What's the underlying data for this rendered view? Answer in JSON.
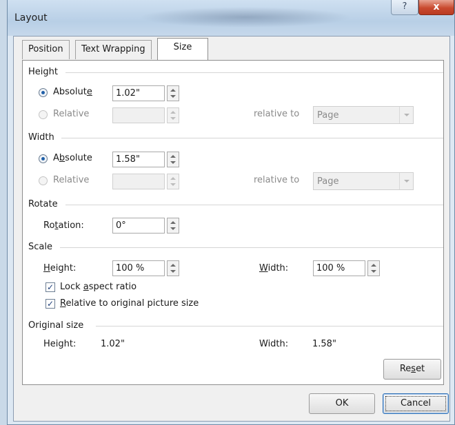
{
  "window": {
    "title": "Layout",
    "help_glyph": "?",
    "close_glyph": "x"
  },
  "tabs": [
    {
      "label": "Position",
      "selected": false
    },
    {
      "label": "Text Wrapping",
      "selected": false
    },
    {
      "label": "Size",
      "selected": true
    }
  ],
  "height": {
    "section_label": "Height",
    "absolute": {
      "pre": "Absolut",
      "key": "e",
      "post": "",
      "value": "1.02\"",
      "selected": true
    },
    "relative": {
      "label": "Relative",
      "value": "",
      "enabled": false
    },
    "relative_to": {
      "label": "relative to",
      "value": "Page",
      "enabled": false
    }
  },
  "width": {
    "section_label": "Width",
    "absolute": {
      "pre": "A",
      "key": "b",
      "post": "solute",
      "value": "1.58\"",
      "selected": true
    },
    "relative": {
      "label": "Relative",
      "value": "",
      "enabled": false
    },
    "relative_to": {
      "label": "relative to",
      "value": "Page",
      "enabled": false
    }
  },
  "rotate": {
    "section_label": "Rotate",
    "rotation": {
      "pre": "Ro",
      "key": "t",
      "post": "ation:",
      "value": "0°"
    }
  },
  "scale": {
    "section_label": "Scale",
    "height": {
      "pre": "",
      "key": "H",
      "post": "eight:",
      "value": "100 %"
    },
    "width": {
      "pre": "",
      "key": "W",
      "post": "idth:",
      "value": "100 %"
    },
    "lock_aspect": {
      "pre": "Lock ",
      "key": "a",
      "post": "spect ratio",
      "checked": true
    },
    "relative_original": {
      "pre": "",
      "key": "R",
      "post": "elative to original picture size",
      "checked": true
    }
  },
  "original_size": {
    "section_label": "Original size",
    "height_label": "Height:",
    "height_value": "1.02\"",
    "width_label": "Width:",
    "width_value": "1.58\""
  },
  "buttons": {
    "reset": {
      "pre": "Re",
      "key": "s",
      "post": "et"
    },
    "ok": "OK",
    "cancel": "Cancel"
  },
  "icons": {
    "check": "✓"
  },
  "colors": {
    "accent": "#1f5fa8",
    "close": "#c94a2f",
    "dialog_bg": "#dde8f3"
  }
}
